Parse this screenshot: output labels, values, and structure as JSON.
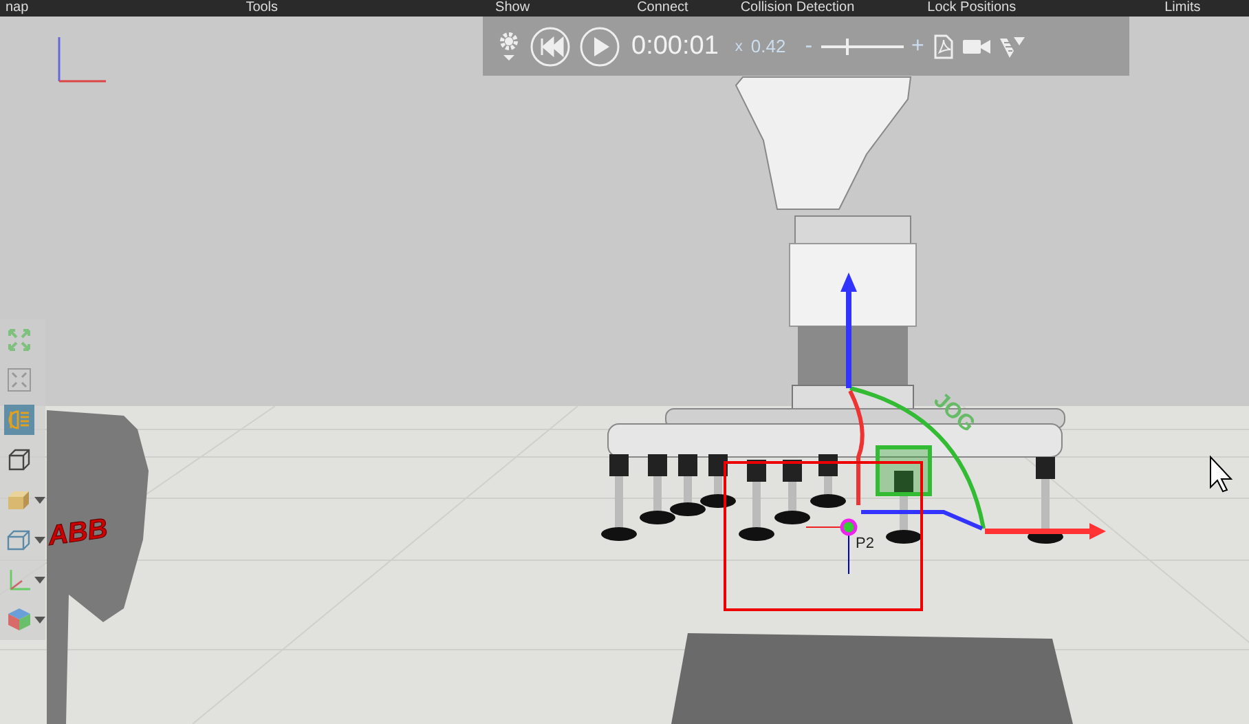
{
  "menu": [
    {
      "label": "nap"
    },
    {
      "label": "Tools"
    },
    {
      "label": "Show"
    },
    {
      "label": "Connect"
    },
    {
      "label": "Collision Detection"
    },
    {
      "label": "Lock Positions"
    },
    {
      "label": "Limits"
    }
  ],
  "playback": {
    "time": "0:00:01",
    "speed_prefix": "x",
    "speed": "0.42",
    "minus": "-",
    "plus": "+",
    "level": 0.3
  },
  "left_toolbar": [
    {
      "kind": "expand",
      "selected": false,
      "dropdown": false
    },
    {
      "kind": "fit",
      "selected": false,
      "dropdown": false
    },
    {
      "kind": "light",
      "selected": true,
      "dropdown": false
    },
    {
      "kind": "box",
      "selected": false,
      "dropdown": false
    },
    {
      "kind": "solid",
      "selected": false,
      "dropdown": true
    },
    {
      "kind": "frame",
      "selected": false,
      "dropdown": true
    },
    {
      "kind": "axes",
      "selected": false,
      "dropdown": true
    },
    {
      "kind": "cube",
      "selected": false,
      "dropdown": true
    }
  ],
  "scene": {
    "labels": [
      {
        "kind": "logo",
        "text": "ABB"
      },
      {
        "kind": "jog",
        "text": "JOG"
      },
      {
        "kind": "target",
        "text": "P2"
      }
    ]
  }
}
